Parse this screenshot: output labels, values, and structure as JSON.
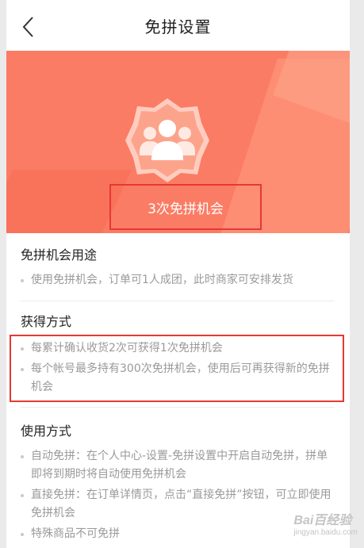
{
  "header": {
    "title": "免拼设置",
    "back_icon": "chevron-left-icon"
  },
  "hero": {
    "count_text": "3次免拼机会",
    "badge_icon": "group-users-icon",
    "colors": {
      "bg": "#fb7c64",
      "box": "#e53935"
    }
  },
  "sections": [
    {
      "title": "免拼机会用途",
      "items": [
        "使用免拼机会，订单可1人成团，此时商家可安排发货"
      ]
    },
    {
      "title": "获得方式",
      "items": [
        "每累计确认收货2次可获得1次免拼机会",
        "每个帐号最多持有300次免拼机会，使用后可再获得新的免拼机会"
      ]
    },
    {
      "title": "使用方式",
      "items": [
        "自动免拼：在个人中心-设置-免拼设置中开启自动免拼，拼单即将到期时将自动使用免拼机会",
        "直接免拼：在订单详情页，点击“直接免拼”按钮，可立即使用免拼机会",
        "特殊商品不可免拼"
      ]
    }
  ],
  "watermark": {
    "text": "Bai百经验",
    "sub": "jingyan.baidu.com"
  }
}
